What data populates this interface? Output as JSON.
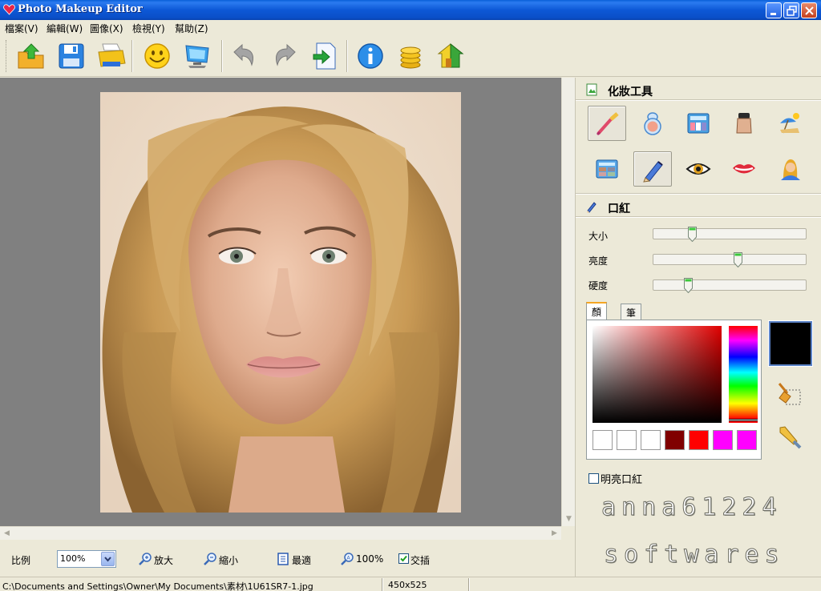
{
  "window": {
    "title": "Photo Makeup Editor"
  },
  "menu": [
    "檔案(V)",
    "編輯(W)",
    "圖像(X)",
    "檢視(Y)",
    "幫助(Z)"
  ],
  "toolbar": {
    "buttons": [
      "open-icon",
      "save-icon",
      "print-icon",
      "smiley-icon",
      "monitor-icon",
      "undo-icon",
      "redo-icon",
      "export-icon",
      "info-icon",
      "coins-icon",
      "home-icon"
    ]
  },
  "makeup_tools": {
    "title": "化妝工具",
    "tools": [
      "brush-icon",
      "compact-icon",
      "palette-box-icon",
      "foundation-icon",
      "beach-icon",
      "eyeshadow-icon",
      "pencil-icon",
      "eye-icon",
      "lips-icon",
      "person-icon"
    ],
    "selected": "pencil-icon"
  },
  "lipstick": {
    "title": "口紅",
    "sliders": [
      {
        "label": "大小",
        "value": 0.24
      },
      {
        "label": "亮度",
        "value": 0.56
      },
      {
        "label": "硬度",
        "value": 0.21
      }
    ],
    "tabs": [
      "顏色",
      "筆刷"
    ],
    "active_tab": "顏色",
    "swatches": [
      "#ffffff",
      "#ffffff",
      "#ffffff",
      "#800000",
      "#ff0000",
      "#ff00ff",
      "#ff00ff"
    ],
    "current_color": "#000000",
    "bright_checkbox": {
      "label": "明亮口紅",
      "checked": false
    }
  },
  "watermark": {
    "line1": "anna61224",
    "line2": "softwares"
  },
  "zoom_bar": {
    "ratio_label": "比例",
    "zoom_value": "100%",
    "zoom_in": "放大",
    "zoom_out": "縮小",
    "fit": "最適",
    "actual": "100%",
    "interpolate": "交插",
    "interpolate_checked": true
  },
  "status": {
    "path": "C:\\Documents and Settings\\Owner\\My Documents\\素材\\1U61SR7-1.jpg",
    "dimensions": "450x525"
  }
}
